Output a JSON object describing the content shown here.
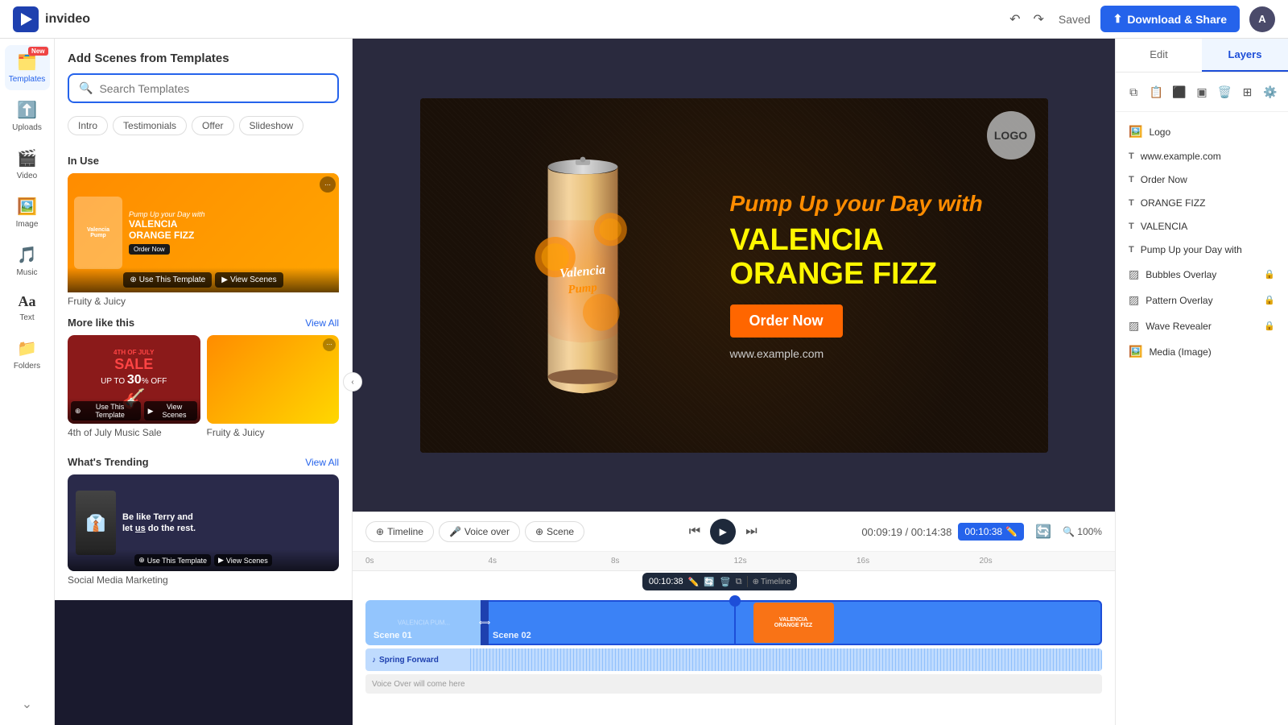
{
  "app": {
    "name": "invideo",
    "logo_text": "invideo"
  },
  "topnav": {
    "saved_label": "Saved",
    "download_label": "Download & Share",
    "avatar_label": "A"
  },
  "sidebar": {
    "items": [
      {
        "id": "templates",
        "label": "Templates",
        "icon": "🗂️",
        "is_new": true,
        "active": true
      },
      {
        "id": "uploads",
        "label": "Uploads",
        "icon": "⬆️",
        "is_new": false,
        "active": false
      },
      {
        "id": "video",
        "label": "Video",
        "icon": "🎬",
        "is_new": false,
        "active": false
      },
      {
        "id": "image",
        "label": "Image",
        "icon": "🖼️",
        "is_new": false,
        "active": false
      },
      {
        "id": "music",
        "label": "Music",
        "icon": "🎵",
        "is_new": false,
        "active": false
      },
      {
        "id": "text",
        "label": "Text",
        "icon": "Aa",
        "is_new": false,
        "active": false
      },
      {
        "id": "folders",
        "label": "Folders",
        "icon": "📁",
        "is_new": false,
        "active": false
      }
    ]
  },
  "templates_panel": {
    "title": "Add Scenes from Templates",
    "search_placeholder": "Search Templates",
    "filters": [
      "Intro",
      "Testimonials",
      "Offer",
      "Slideshow"
    ],
    "in_use_label": "In Use",
    "in_use_card": {
      "name": "Fruity & Juicy",
      "use_btn": "Use This Template",
      "view_btn": "View Scenes"
    },
    "more_like_this_label": "More like this",
    "view_all_label": "View All",
    "card1_name": "4th of July Music Sale",
    "what_trending_label": "What's Trending",
    "trending_card_name": "Social Media Marketing"
  },
  "canvas": {
    "pump_text": "Pump Up your Day with",
    "title_line1": "VALENCIA",
    "title_line2": "ORANGE FIZZ",
    "order_btn": "Order Now",
    "url_text": "www.example.com",
    "logo_text": "LOGO"
  },
  "timeline": {
    "timeline_btn": "Timeline",
    "voiceover_btn": "Voice over",
    "scene_btn": "Scene",
    "time_current": "00:09:19",
    "time_total": "00:14:38",
    "time_input": "00:10:38",
    "zoom": "100%",
    "scene1_label": "Scene 01",
    "scene2_label": "Scene 02",
    "audio_label": "Spring Forward",
    "voiceover_placeholder": "Voice Over will come here",
    "popup_time": "00:10:38",
    "ruler_marks": [
      "0s",
      "4s",
      "8s",
      "12s",
      "16s",
      "20s"
    ]
  },
  "right_panel": {
    "tab_edit": "Edit",
    "tab_layers": "Layers",
    "active_tab": "Layers",
    "layers": [
      {
        "id": "logo",
        "name": "Logo",
        "icon": "logo",
        "locked": false
      },
      {
        "id": "url",
        "name": "www.example.com",
        "icon": "text",
        "locked": false
      },
      {
        "id": "order",
        "name": "Order Now",
        "icon": "text",
        "locked": false
      },
      {
        "id": "orange_fizz",
        "name": "ORANGE FIZZ",
        "icon": "text",
        "locked": false
      },
      {
        "id": "valencia",
        "name": "VALENCIA",
        "icon": "text",
        "locked": false
      },
      {
        "id": "pump",
        "name": "Pump Up your Day with",
        "icon": "text",
        "locked": false
      },
      {
        "id": "bubbles",
        "name": "Bubbles Overlay",
        "icon": "overlay",
        "locked": true
      },
      {
        "id": "pattern",
        "name": "Pattern Overlay",
        "icon": "overlay",
        "locked": true
      },
      {
        "id": "wave",
        "name": "Wave Revealer",
        "icon": "overlay",
        "locked": true
      },
      {
        "id": "media",
        "name": "Media (Image)",
        "icon": "image",
        "locked": false
      }
    ]
  }
}
